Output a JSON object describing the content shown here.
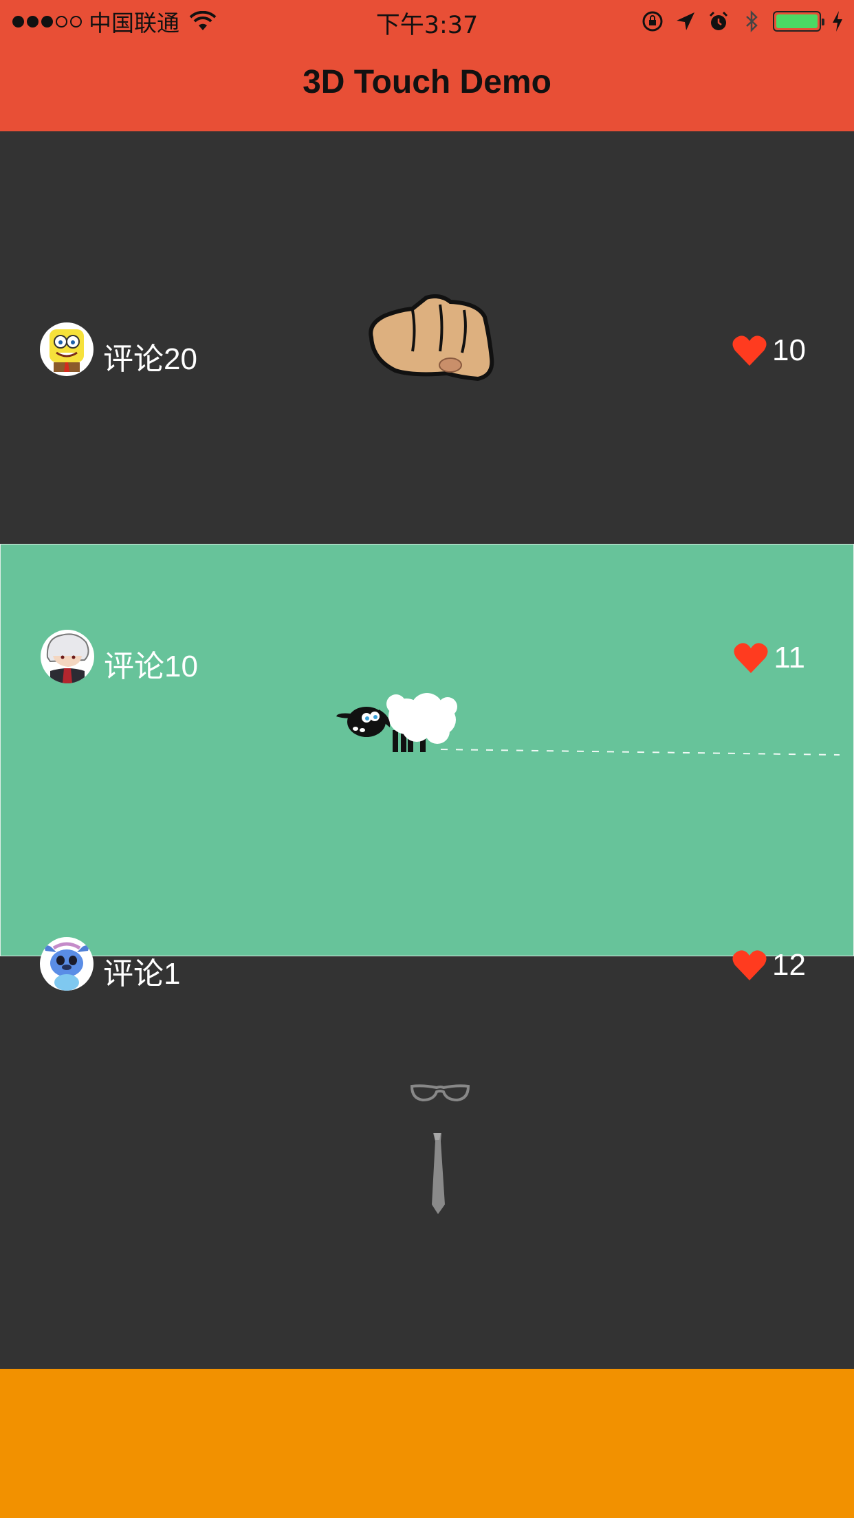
{
  "status_bar": {
    "signal_filled": 3,
    "signal_total": 5,
    "carrier": "中国联通",
    "time": "下午3:37",
    "icons": [
      "wifi-icon",
      "orientation-lock-icon",
      "location-arrow-icon",
      "alarm-icon",
      "bluetooth-icon",
      "battery-icon",
      "charging-icon"
    ]
  },
  "nav": {
    "title": "3D Touch Demo"
  },
  "colors": {
    "nav_bg": "#E84F36",
    "card_dark": "#333333",
    "card_green": "#67C39A",
    "bottom_bg": "#F29100",
    "heart": "#FF3B1F"
  },
  "cards": [
    {
      "art_icon": "fist-icon",
      "avatar_icon": "spongebob-avatar-icon",
      "comment": "评论20",
      "likes": "10",
      "bg": "dark"
    },
    {
      "art_icon": "sheep-icon",
      "avatar_icon": "gintoki-avatar-icon",
      "comment": "评论10",
      "likes": "11",
      "bg": "green"
    },
    {
      "art_icon": "glasses-tie-icon",
      "avatar_icon": "stitch-avatar-icon",
      "comment": "评论1",
      "likes": "12",
      "bg": "dark"
    }
  ]
}
